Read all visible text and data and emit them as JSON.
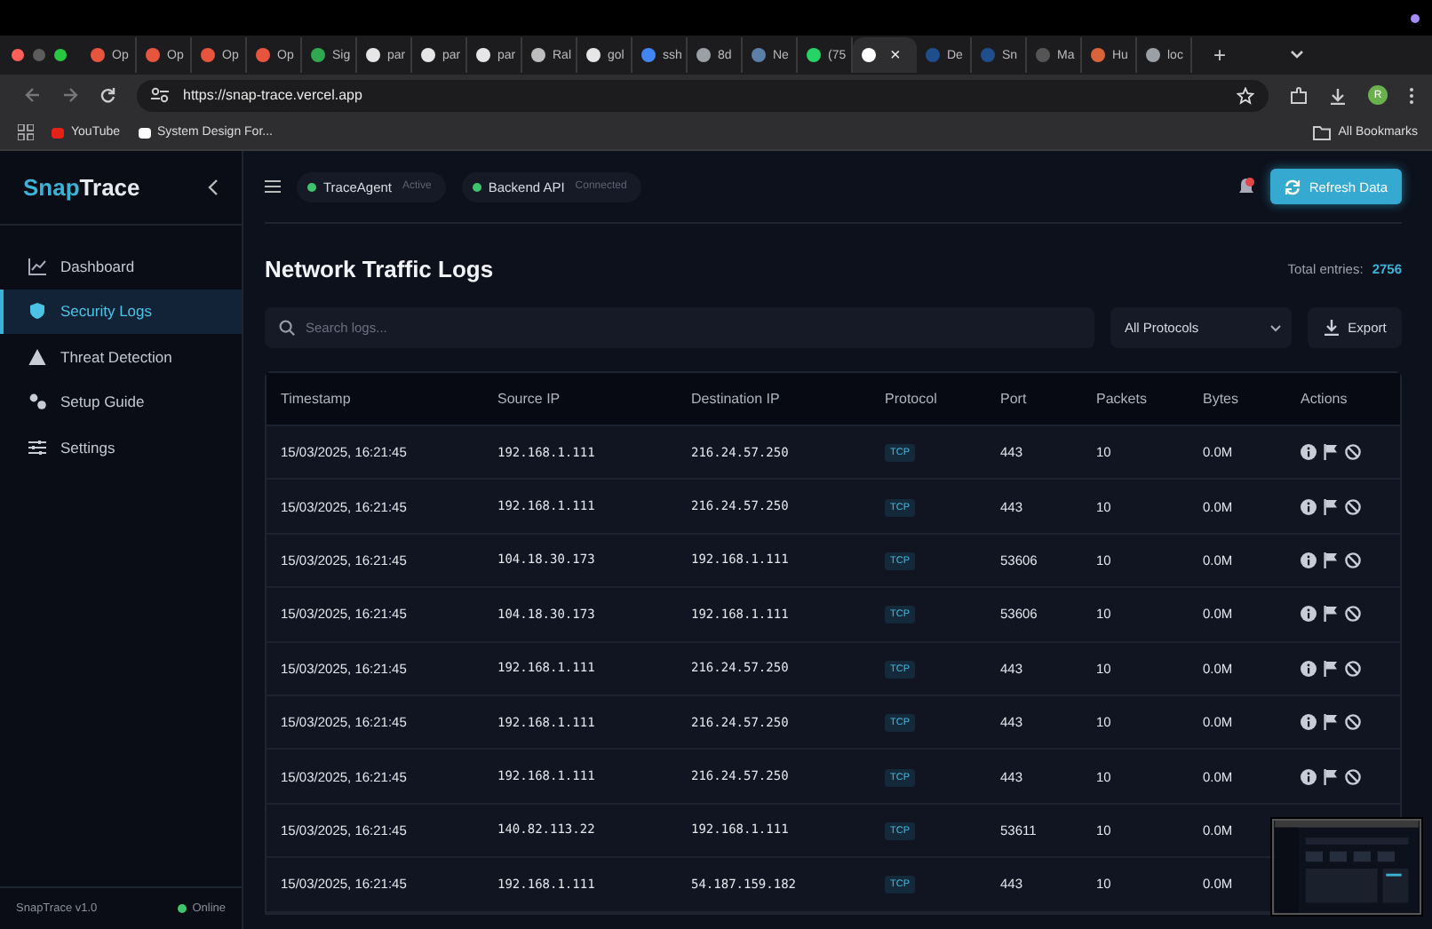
{
  "browser": {
    "tabs": [
      {
        "label": "Op",
        "color": "#e8553e",
        "selected": false
      },
      {
        "label": "Op",
        "color": "#e8553e",
        "selected": false
      },
      {
        "label": "Op",
        "color": "#e8553e",
        "selected": false
      },
      {
        "label": "Op",
        "color": "#e8553e",
        "selected": false
      },
      {
        "label": "Sig",
        "color": "#2fa84f",
        "selected": false
      },
      {
        "label": "par",
        "color": "#e6e6e6",
        "selected": false
      },
      {
        "label": "par",
        "color": "#e6e6e6",
        "selected": false
      },
      {
        "label": "par",
        "color": "#e6e6e6",
        "selected": false
      },
      {
        "label": "Ral",
        "color": "#bdbdbd",
        "selected": false
      },
      {
        "label": "gol",
        "color": "#e6e6e6",
        "selected": false
      },
      {
        "label": "ssh",
        "color": "#4285f4",
        "selected": false
      },
      {
        "label": "8d",
        "color": "#9aa0a6",
        "selected": false
      },
      {
        "label": "Ne",
        "color": "#5a7fa8",
        "selected": false
      },
      {
        "label": "(75",
        "color": "#25d366",
        "selected": false
      },
      {
        "label": "×",
        "color": "#ffffff",
        "selected": true
      },
      {
        "label": "De",
        "color": "#1f4e8c",
        "selected": false
      },
      {
        "label": "Sn",
        "color": "#1f4e8c",
        "selected": false
      },
      {
        "label": "Ma",
        "color": "#555555",
        "selected": false
      },
      {
        "label": "Hu",
        "color": "#d9643a",
        "selected": false
      },
      {
        "label": "loc",
        "color": "#9aa0a6",
        "selected": false
      }
    ],
    "new_tab": "+",
    "url": "https://snap-trace.vercel.app",
    "bookmarks": [
      {
        "label": "YouTube",
        "color": "#e62117"
      },
      {
        "label": "System Design For...",
        "color": "#ffffff"
      }
    ],
    "all_bookmarks": "All Bookmarks",
    "profile": "R"
  },
  "sidebar": {
    "logo": {
      "part1": "Snap",
      "part2": "Trace"
    },
    "items": [
      {
        "label": "Dashboard",
        "selected": false
      },
      {
        "label": "Security Logs",
        "selected": true
      },
      {
        "label": "Threat Detection",
        "selected": false
      },
      {
        "label": "Setup Guide",
        "selected": false
      },
      {
        "label": "Settings",
        "selected": false
      }
    ],
    "version": "SnapTrace v1.0",
    "status": "Online"
  },
  "header": {
    "services": [
      {
        "name": "TraceAgent",
        "status": "Active",
        "on": true
      },
      {
        "name": "Backend API",
        "status": "Connected",
        "on": true
      }
    ],
    "notifications": true,
    "refresh_button": "Refresh Data"
  },
  "page": {
    "title": "Network Traffic Logs",
    "total_label": "Total entries:",
    "total": "2756",
    "search": {
      "placeholder": "Search logs..."
    },
    "protocol_filter": "All Protocols",
    "export_button": "Export"
  },
  "table": {
    "columns": [
      "Timestamp",
      "Source IP",
      "Destination IP",
      "Protocol",
      "Port",
      "Packets",
      "Bytes",
      "Actions"
    ],
    "rows": [
      {
        "timestamp": "15/03/2025, 16:21:45",
        "source": "192.168.1.111",
        "destination": "216.24.57.250",
        "protocol": "TCP",
        "port": "443",
        "packets": "10",
        "bytes": "0.0M",
        "actions_shown": true
      },
      {
        "timestamp": "15/03/2025, 16:21:45",
        "source": "192.168.1.111",
        "destination": "216.24.57.250",
        "protocol": "TCP",
        "port": "443",
        "packets": "10",
        "bytes": "0.0M",
        "actions_shown": true
      },
      {
        "timestamp": "15/03/2025, 16:21:45",
        "source": "104.18.30.173",
        "destination": "192.168.1.111",
        "protocol": "TCP",
        "port": "53606",
        "packets": "10",
        "bytes": "0.0M",
        "actions_shown": true
      },
      {
        "timestamp": "15/03/2025, 16:21:45",
        "source": "104.18.30.173",
        "destination": "192.168.1.111",
        "protocol": "TCP",
        "port": "53606",
        "packets": "10",
        "bytes": "0.0M",
        "actions_shown": true
      },
      {
        "timestamp": "15/03/2025, 16:21:45",
        "source": "192.168.1.111",
        "destination": "216.24.57.250",
        "protocol": "TCP",
        "port": "443",
        "packets": "10",
        "bytes": "0.0M",
        "actions_shown": true
      },
      {
        "timestamp": "15/03/2025, 16:21:45",
        "source": "192.168.1.111",
        "destination": "216.24.57.250",
        "protocol": "TCP",
        "port": "443",
        "packets": "10",
        "bytes": "0.0M",
        "actions_shown": true
      },
      {
        "timestamp": "15/03/2025, 16:21:45",
        "source": "192.168.1.111",
        "destination": "216.24.57.250",
        "protocol": "TCP",
        "port": "443",
        "packets": "10",
        "bytes": "0.0M",
        "actions_shown": true
      },
      {
        "timestamp": "15/03/2025, 16:21:45",
        "source": "140.82.113.22",
        "destination": "192.168.1.111",
        "protocol": "TCP",
        "port": "53611",
        "packets": "10",
        "bytes": "0.0M",
        "actions_shown": false
      },
      {
        "timestamp": "15/03/2025, 16:21:45",
        "source": "192.168.1.111",
        "destination": "54.187.159.182",
        "protocol": "TCP",
        "port": "443",
        "packets": "10",
        "bytes": "0.0M",
        "actions_shown": false
      }
    ]
  }
}
